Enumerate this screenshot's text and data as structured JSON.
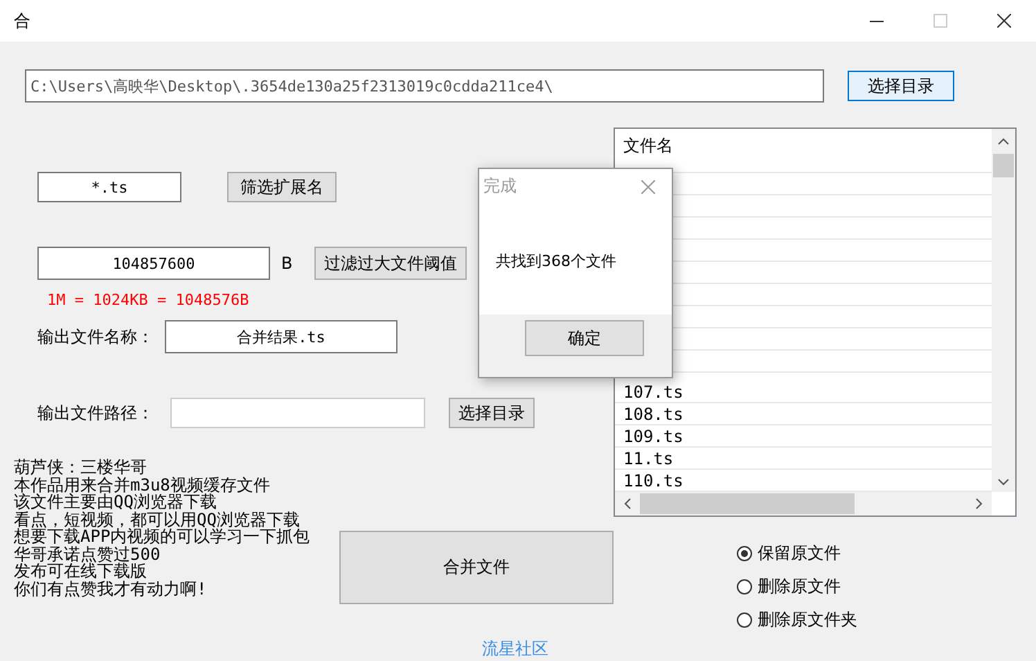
{
  "window": {
    "title": "合"
  },
  "path_field": {
    "value": "C:\\Users\\高映华\\Desktop\\.3654de130a25f2313019c0cdda211ce4\\"
  },
  "choose_dir_button": "选择目录",
  "extension": {
    "value": "*.ts",
    "button": "筛选扩展名"
  },
  "size_limit": {
    "value": "104857600",
    "unit": "B",
    "button": "过滤过大文件阈值",
    "hint": "1M = 1024KB = 1048576B"
  },
  "output_name": {
    "label": "输出文件名称：",
    "value": "合并结果.ts"
  },
  "output_path": {
    "label": "输出文件路径：",
    "button": "选择目录"
  },
  "notes": [
    "葫芦侠：三楼华哥",
    "本作品用来合并m3u8视频缓存文件",
    "该文件主要由QQ浏览器下载",
    "看点，短视频，都可以用QQ浏览器下载",
    "想要下载APP内视频的可以学习一下抓包",
    "华哥承诺点赞过500",
    "发布可在线下载版",
    "你们有点赞我才有动力啊!"
  ],
  "merge_button": "合并文件",
  "file_list": {
    "header": "文件名",
    "rows": [
      "107.ts",
      "108.ts",
      "109.ts",
      "11.ts",
      "110.ts"
    ]
  },
  "options": [
    {
      "label": "保留原文件",
      "selected": true
    },
    {
      "label": "删除原文件",
      "selected": false
    },
    {
      "label": "删除原文件夹",
      "selected": false
    }
  ],
  "footer_link": "流星社区",
  "dialog": {
    "title": "完成",
    "message": "共找到368个文件",
    "button": "确定"
  }
}
